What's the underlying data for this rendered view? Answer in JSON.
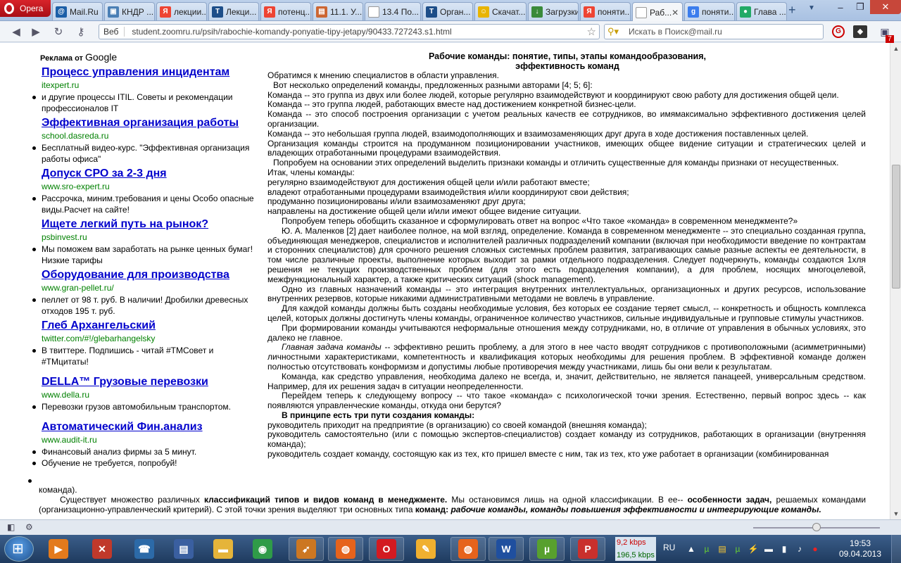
{
  "browser": {
    "menu_label": "Opera",
    "tabs": [
      {
        "label": "Mail.Ru",
        "icon": "mail-ru-icon",
        "color": "#1b5fa8",
        "glyph": "@"
      },
      {
        "label": "КНДР ...",
        "icon": "image-icon",
        "color": "#4a7fb5",
        "glyph": "▣"
      },
      {
        "label": "лекции...",
        "icon": "yandex-icon",
        "color": "#e43",
        "glyph": "Я"
      },
      {
        "label": "Лекци...",
        "icon": "t-icon",
        "color": "#1d4e89",
        "glyph": "T"
      },
      {
        "label": "потенц...",
        "icon": "yandex-icon",
        "color": "#e43",
        "glyph": "Я"
      },
      {
        "label": "11.1. У...",
        "icon": "book-icon",
        "color": "#c63",
        "glyph": "▤"
      },
      {
        "label": "13.4 По...",
        "icon": "page-icon",
        "color": "#ffffff",
        "glyph": ""
      },
      {
        "label": "Орган...",
        "icon": "t-icon",
        "color": "#1d4e89",
        "glyph": "T"
      },
      {
        "label": "Скачат...",
        "icon": "smiley-icon",
        "color": "#e8b400",
        "glyph": "☺"
      },
      {
        "label": "Загрузки",
        "icon": "downloads-icon",
        "color": "#3a8a3a",
        "glyph": "↓"
      },
      {
        "label": "поняти...",
        "icon": "yandex-icon",
        "color": "#e43",
        "glyph": "Я"
      },
      {
        "label": "Раб...",
        "icon": "page-icon",
        "color": "#ffffff",
        "glyph": ""
      },
      {
        "label": "поняти...",
        "icon": "google-icon",
        "color": "#3b7ded",
        "glyph": "g"
      },
      {
        "label": "Глава ...",
        "icon": "globe-icon",
        "color": "#2a6",
        "glyph": "●"
      }
    ],
    "active_tab": 11,
    "address": {
      "prefix": "Веб",
      "url": "student.zoomru.ru/psih/rabochie-komandy-ponyatie-tipy-jetapy/90433.727243.s1.html"
    },
    "search": {
      "placeholder": "Искать в Поиск@mail.ru"
    },
    "notifications_badge": "7"
  },
  "ads": {
    "label": "Реклама от",
    "label_brand": "Google",
    "items": [
      {
        "title": "Процесс управления инцидентам",
        "url": "itexpert.ru",
        "desc": [
          "и другие процессы ITIL. Советы и рекомендации профессионалов IT"
        ]
      },
      {
        "title": "Эффективная организация работы",
        "url": "school.dasreda.ru",
        "desc": [
          "Бесплатный видео-курс. \"Эффективная организация работы офиса\""
        ]
      },
      {
        "title": "Допуск СРО за 2-3 дня",
        "url": "www.sro-expert.ru",
        "desc": [
          "Рассрочка, миним.требования и цены Особо опасные виды.Расчет на сайте!"
        ]
      },
      {
        "title": "Ищете легкий путь на рынок?",
        "url": "psbinvest.ru",
        "desc": [
          "Мы поможем вам заработать на рынке ценных бумаг! Низкие тарифы"
        ]
      },
      {
        "title": "Оборудование для производства",
        "url": "www.gran-pellet.ru/",
        "desc": [
          "пеллет от 98 т. руб. В наличии! Дробилки древесных отходов 195 т. руб."
        ]
      },
      {
        "title": "Глеб Архангельский",
        "url": "twitter.com/#!/glebarhangelsky",
        "desc": [
          "В твиттере. Подпишись - читай #ТМСовет и #ТМцитаты!"
        ]
      },
      {
        "title": "DELLA™ Грузовые перевозки",
        "url": "www.della.ru",
        "desc": [
          "Перевозки грузов автомобильным транспортом."
        ]
      },
      {
        "title": "Автоматический Фин.анализ",
        "url": "www.audit-it.ru",
        "desc": [
          "Финансовый анализ фирмы за 5 минут.",
          "Обучение не требуется, попробуй!"
        ]
      }
    ]
  },
  "article": {
    "title_line1": "Рабочие команды: понятие, типы, этапы командообразования,",
    "title_line2": "эффективность команд",
    "paragraphs": [
      "Обратимся к мнению специалистов в области управления.",
      "Вот несколько определений команды, предложенных разными авторами [4; 5; 6]:",
      "Команда -- это группа из двух или более людей, которые регулярно взаимодействуют и координируют свою работу для достижения общей цели.",
      "Команда -- это группа людей, работающих вместе над достижением конкретной бизнес-цели.",
      "Команда -- это способ построения организации с учетом реальных качеств ее сотрудников, во имямаксимально эффективного достижения целей организации.",
      "Команда -- это небольшая группа людей, взаимодополняющих и взаимозаменяющих друг друга в ходе достижения поставленных целей.",
      "Организация команды строится на продуманном позиционировании участников, имеющих общее видение ситуации и стратегических целей и владеющих отработанными процедурами взаимодействия.",
      "Попробуем на основании этих определений выделить признаки команды и отличить существенные для команды признаки от несущественных.",
      "Итак, члены команды:",
      "регулярно взаимодействуют для достижения общей цели и/или работают вместе;",
      "владеют отработанными процедурами взаимодействия и/или координируют свои действия;",
      "продуманно позиционированы и/или взаимозаменяют друг друга;",
      "направлены на достижение общей цели и/или имеют общее видение ситуации.",
      "Попробуем теперь обобщить сказанное и сформулировать ответ на вопрос «Что такое «команда» в современном менеджменте?»",
      "Ю. А. Маленков [2] дает наиболее полное, на мой взгляд, определение. Команда в современном менеджменте -- это специально созданная группа, объединяющая менеджеров, специалистов и исполнителей различных подразделений компании (включая при необходимости введение по контрактам и сторонних специалистов) для срочного решения сложных системных проблем развития, затрагивающих самые разные аспекты ее деятельности, в том числе различные проекты, выполнение которых выходит за рамки отдельного подразделения. Следует подчеркнуть, команды создаются 1хля решения не текущих производственных проблем (для этого есть подразделения компании), а для проблем, носящих многоцелевой, межфункциональный характер, а также критических ситуаций (shock management).",
      "Одно из главных назначений команды -- это интеграция внутренних интеллектуальных, организационных и других ресурсов, использование внутренних резервов, которые никакими административными методами не вовлечь в управление.",
      "Для каждой команды должны быть созданы необходимые условия, без которых ее создание теряет смысл, -- конкретность и общность комплекса целей, которых должны достигнуть члены команды, ограниченное количество участников, сильные индивидуальные и групповые стимулы участников.",
      "При формировании команды учитываются неформальные отношения между сотрудниками, но, в отличие от управления в обычных условиях, это далеко не главное.",
      "-- эффективно решить проблему, а для этого в нее часто вводят сотрудников с противоположными (асимметричными) личностными характеристиками, компетентность и квалификация которых необходимы для решения проблем. В эффективной команде должен полностью отсутствовать конформизм и допустимы любые противоречия между участниками, лишь бы они вели к результатам.",
      "Команда, как средство управления, необходима далеко не всегда, и, значит, действительно, не является панацеей, универсальным средством. Например, для их решения задач в ситуации неопределенности.",
      "Перейдем теперь к следующему вопросу -- что такое «команда» с психологической точки зрения. Естественно, первый вопрос здесь -- как появляются управленческие команды, откуда они берутся?",
      "В принципе есть три пути создания команды:",
      "руководитель приходит на предприятие (в организацию) со своей командой (внешняя команда);",
      "руководитель самостоятельно (или с помощью экспертов-специалистов) создает команду из сотрудников, работающих в организации (внутренняя команда);",
      "руководитель создает команду, состоящую как из тех, кто пришел вместе с ним, так из тех, кто уже работает в организации (комбинированная",
      "команда)."
    ],
    "italic_lead": "Главная задача команды",
    "classif": {
      "t1": "Существует множество различных ",
      "b1": "классификаций типов и видов команд в менеджменте.",
      "t2": " Мы остановимся лишь на одной классификации. В ее-- ",
      "b2": "особенности задач,",
      "t3": " решаемых командами (организационно-управленческий критерий). С этой точки зрения выделяют три основных типа ",
      "b3": "команд:",
      "bi": " рабочие команды, команды повышения эффективности и интегрирующие команды."
    }
  },
  "status": {
    "icons": [
      "panel-toggle-icon",
      "speed-dial-icon"
    ],
    "zoom_level": 0.5
  },
  "taskbar": {
    "apps": [
      {
        "name": "media-player-icon",
        "color": "#e37a1c",
        "glyph": "▶"
      },
      {
        "name": "cross-app-icon",
        "color": "#c0392b",
        "glyph": "✕"
      },
      {
        "name": "phone-app-icon",
        "color": "#2c6aa8",
        "glyph": "☎"
      },
      {
        "name": "floppy-icon",
        "color": "#3a5fa0",
        "glyph": "▤"
      },
      {
        "name": "folder-icon",
        "color": "#e5b43a",
        "glyph": "▬"
      },
      {
        "name": "chrome-icon",
        "color": "#2f9b48",
        "glyph": "◉"
      },
      {
        "name": "rabbit-icon",
        "color": "#c72",
        "glyph": "➹"
      },
      {
        "name": "firefox-icon",
        "color": "#e6631c",
        "glyph": "◍"
      },
      {
        "name": "opera-icon",
        "color": "#d31a21",
        "glyph": "O"
      },
      {
        "name": "pencil-app-icon",
        "color": "#f0b030",
        "glyph": "✎"
      },
      {
        "name": "firefox-icon-2",
        "color": "#e6631c",
        "glyph": "◍"
      },
      {
        "name": "word-icon",
        "color": "#1f4f9f",
        "glyph": "W"
      },
      {
        "name": "utorrent-icon",
        "color": "#58a02e",
        "glyph": "µ"
      },
      {
        "name": "pdf-icon",
        "color": "#c9302c",
        "glyph": "P"
      }
    ],
    "net_down": "9,2 kbps",
    "net_up": "196,5 kbps",
    "lang": "RU",
    "time": "19:53",
    "date": "09.04.2013"
  }
}
